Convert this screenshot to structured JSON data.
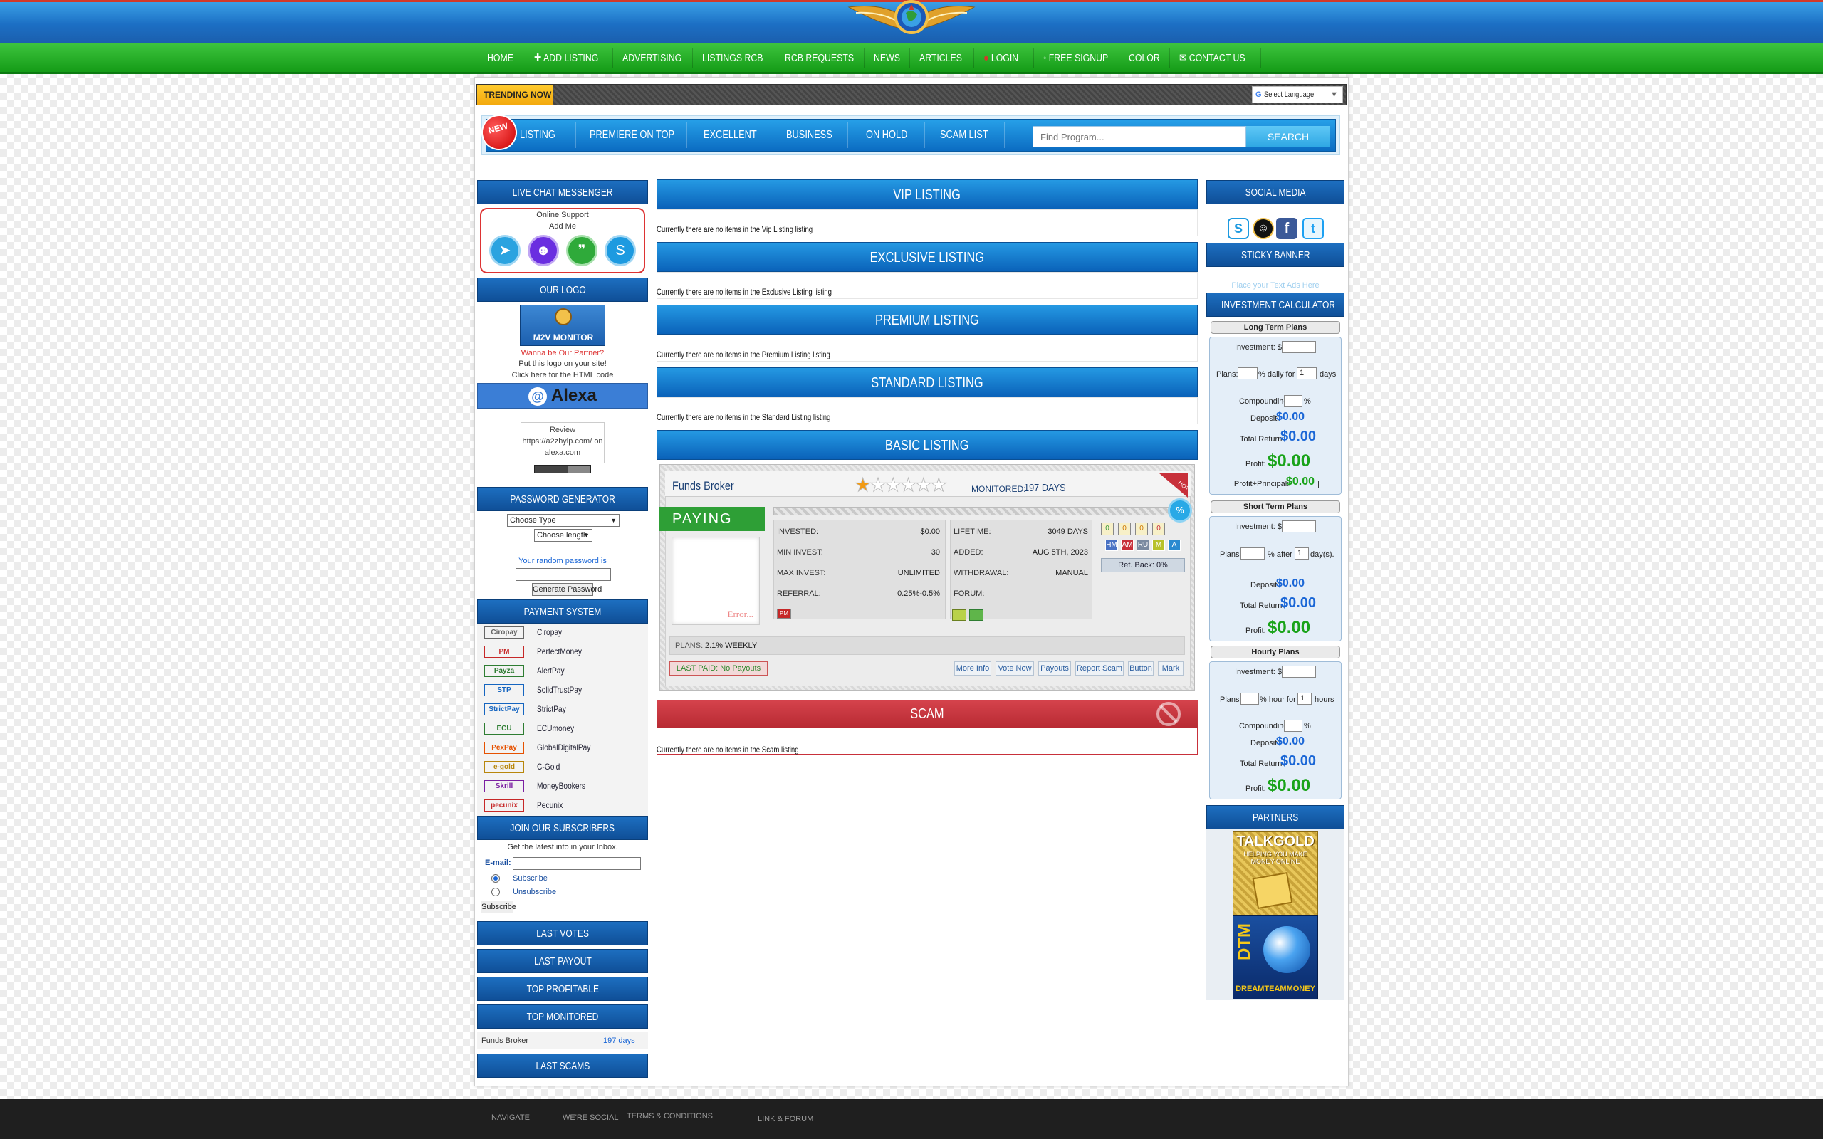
{
  "nav": {
    "items": [
      "HOME",
      "ADD LISTING",
      "ADVERTISING",
      "LISTINGS RCB",
      "RCB REQUESTS",
      "NEWS",
      "ARTICLES",
      "LOGIN",
      "FREE SIGNUP",
      "COLOR",
      "CONTACT US"
    ]
  },
  "trending": {
    "label": "TRENDING NOW",
    "language": "Select Language"
  },
  "categories": {
    "new_badge": "NEW",
    "items": [
      "LISTING",
      "PREMIERE ON TOP",
      "EXCELLENT",
      "BUSINESS",
      "ON HOLD",
      "SCAM LIST"
    ],
    "search_placeholder": "Find Program...",
    "search_button": "SEARCH"
  },
  "left": {
    "live_chat": {
      "title": "LIVE CHAT MESSENGER",
      "line1": "Online Support",
      "line2": "Add Me"
    },
    "our_logo": {
      "title": "OUR LOGO",
      "logo_text": "M2V MONITOR",
      "partner": "Wanna be Our Partner?",
      "put": "Put this logo on your site!",
      "click": "Click here for the HTML code"
    },
    "alexa": {
      "label": "Alexa",
      "review": "Review https://a2zhyip.com/ on alexa.com"
    },
    "password": {
      "title": "PASSWORD GENERATOR",
      "type": "Choose Type",
      "length": "Choose length",
      "label": "Your random password is",
      "button": "Generate Password"
    },
    "payment": {
      "title": "PAYMENT SYSTEM",
      "items": [
        {
          "icon": "Ciropay",
          "label": "Ciropay",
          "color": "#666666"
        },
        {
          "icon": "PM",
          "label": "PerfectMoney",
          "color": "#c62828"
        },
        {
          "icon": "Payza",
          "label": "AlertPay",
          "color": "#2e7d32"
        },
        {
          "icon": "STP",
          "label": "SolidTrustPay",
          "color": "#1565c0"
        },
        {
          "icon": "StrictPay",
          "label": "StrictPay",
          "color": "#1565c0"
        },
        {
          "icon": "ECU",
          "label": "ECUmoney",
          "color": "#2e7d32"
        },
        {
          "icon": "PexPay",
          "label": "GlobalDigitalPay",
          "color": "#e65100"
        },
        {
          "icon": "e-gold",
          "label": "C-Gold",
          "color": "#b8860b"
        },
        {
          "icon": "Skrill",
          "label": "MoneyBookers",
          "color": "#7b1fa2"
        },
        {
          "icon": "pecunix",
          "label": "Pecunix",
          "color": "#c62828"
        }
      ]
    },
    "subscribers": {
      "title": "JOIN OUR SUBSCRIBERS",
      "info": "Get the latest info in your Inbox.",
      "email_label": "E-mail:",
      "subscribe": "Subscribe",
      "unsubscribe": "Unsubscribe",
      "button": "Subscribe"
    },
    "last_votes": "LAST VOTES",
    "last_payout": "LAST PAYOUT",
    "top_profitable": "TOP PROFITABLE",
    "top_monitored": {
      "title": "TOP MONITORED",
      "name": "Funds Broker",
      "days": "197 days"
    },
    "last_scams": "LAST SCAMS"
  },
  "center": {
    "vip": {
      "title": "VIP LISTING",
      "note": "Currently there are no items in the Vip Listing listing"
    },
    "exclusive": {
      "title": "EXCLUSIVE LISTING",
      "note": "Currently there are no items in the Exclusive Listing listing"
    },
    "premium": {
      "title": "PREMIUM LISTING",
      "note": "Currently there are no items in the Premium Listing listing"
    },
    "standard": {
      "title": "STANDARD LISTING",
      "note": "Currently there are no items in the Standard Listing listing"
    },
    "basic": {
      "title": "BASIC LISTING"
    },
    "program": {
      "name": "Funds Broker",
      "rating_stars": 1,
      "rating_max": 6,
      "monitored_label": "MONITORED:",
      "monitored_value": "197 DAYS",
      "hot": "HOT",
      "status": "PAYING",
      "error": "Error...",
      "invested_label": "INVESTED:",
      "invested": "$0.00",
      "min_label": "MIN INVEST:",
      "min": "30",
      "max_label": "MAX INVEST:",
      "max": "UNLIMITED",
      "referral_label": "REFERRAL:",
      "referral": "0.25%-0.5%",
      "lifetime_label": "LIFETIME:",
      "lifetime": "3049 DAYS",
      "added_label": "ADDED:",
      "added": "AUG 5TH, 2023",
      "withdrawal_label": "WITHDRAWAL:",
      "withdrawal": "MANUAL",
      "forum_label": "FORUM:",
      "votes": [
        "0",
        "0",
        "0",
        "0"
      ],
      "monitors": [
        "HM",
        "AM",
        "RU",
        "M",
        "A"
      ],
      "ref_back": "Ref. Back: 0%",
      "plans_label": "PLANS:",
      "plans": "2.1% WEEKLY",
      "last_paid": "LAST PAID: No Payouts",
      "buttons": [
        "More Info",
        "Vote Now",
        "Payouts",
        "Report Scam",
        "Button",
        "Mark"
      ],
      "percent_icon": "%",
      "pm_badge": "PM"
    },
    "scam": {
      "title": "SCAM",
      "note": "Currently there are no items in the Scam listing"
    }
  },
  "right": {
    "social": {
      "title": "SOCIAL MEDIA"
    },
    "sticky": {
      "title": "STICKY BANNER",
      "text": "Place your Text Ads Here"
    },
    "calculator": {
      "title": "INVESTMENT CALCULATOR",
      "long": {
        "title": "Long Term Plans",
        "investment": "Investment: $",
        "plans": "Plans:",
        "daily": "% daily for",
        "days": "days",
        "days_default": "1",
        "compounding": "Compounding:",
        "pct": "%",
        "deposit": "Deposit:",
        "deposit_val": "$0.00",
        "total": "Total Return:",
        "total_val": "$0.00",
        "profit": "Profit:",
        "profit_val": "$0.00",
        "pp_open": "| Profit+Principal:",
        "pp_val": "$0.00",
        "pp_close": "|"
      },
      "short": {
        "title": "Short Term Plans",
        "investment": "Investment: $",
        "plans": "Plans:",
        "after": "% after",
        "days": "day(s).",
        "days_default": "1",
        "deposit": "Deposit:",
        "deposit_val": "$0.00",
        "total": "Total Return:",
        "total_val": "$0.00",
        "profit": "Profit:",
        "profit_val": "$0.00"
      },
      "hourly": {
        "title": "Hourly Plans",
        "investment": "Investment: $",
        "plans": "Plans:",
        "hour": "% hour for",
        "hours": "hours",
        "hours_default": "1",
        "compounding": "Compounding:",
        "pct": "%",
        "deposit": "Deposit:",
        "deposit_val": "$0.00",
        "total": "Total Return:",
        "total_val": "$0.00",
        "profit": "Profit:",
        "profit_val": "$0.00"
      }
    },
    "partners": {
      "title": "PARTNERS",
      "banner1": "TALKGOLD",
      "banner1_sub": "HELPING YOU MAKE MONEY ONLINE",
      "banner2": "DTM",
      "banner2_sub": "DREAMTEAMMONEY"
    }
  },
  "footer": {
    "items": [
      "NAVIGATE",
      "WE'RE SOCIAL",
      "TERMS & CONDITIONS",
      "LINK & FORUM"
    ]
  },
  "colors": {
    "nav_green": "#1cab1e",
    "header_blue": "#1d6fc0",
    "scam_red": "#c8303a",
    "accent_yellow": "#f3a90e"
  }
}
